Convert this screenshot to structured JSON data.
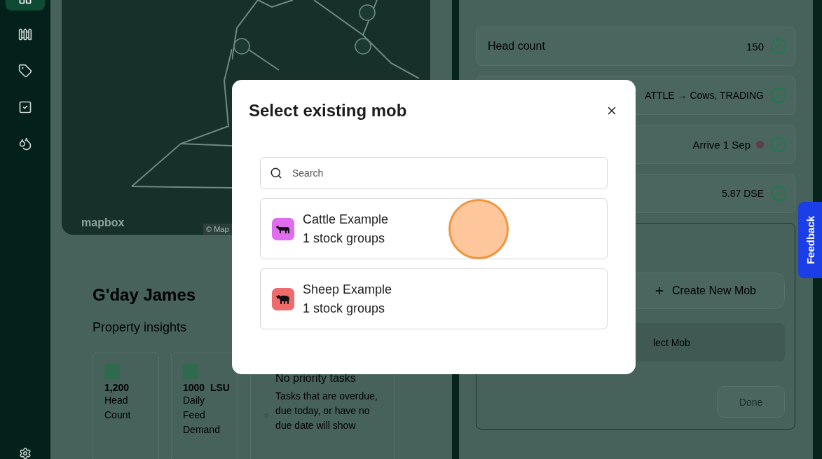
{
  "sidebar": {
    "items": [
      {
        "selected": true
      },
      {
        "selected": false
      },
      {
        "selected": false
      },
      {
        "selected": false
      },
      {
        "selected": false
      }
    ]
  },
  "map": {
    "logo": "mapbox",
    "attribution": "© Map"
  },
  "greeting": "G'day James",
  "insights_title": "Property insights",
  "insights": [
    {
      "kind": "stat",
      "value": "1,200",
      "label": "Head Count"
    },
    {
      "kind": "stat",
      "value": "1000",
      "unit": "LSU",
      "label": "Daily Feed Demand"
    },
    {
      "kind": "tasks",
      "title": "No priority tasks",
      "text": "Tasks that are overdue, due today, or have no due date will show"
    }
  ],
  "details": [
    {
      "label": "Head count",
      "value": "150",
      "done": true
    },
    {
      "value": "ATTLE → Cows, TRADING",
      "done": true
    },
    {
      "value": "Arrive 1 Sep",
      "color": "#5c3f4a",
      "done": true
    },
    {
      "value": "5.87 DSE",
      "done": true
    }
  ],
  "mob_section": {
    "create_button": "Create New Mob",
    "select": "lect Mob",
    "done_button": {
      "label": "Done",
      "disabled": true
    }
  },
  "feedback": "Feedback",
  "modal": {
    "title": "Select existing mob",
    "search": {
      "placeholder": "Search"
    },
    "mobs": [
      {
        "name": "Cattle Example",
        "groups": "1 stock groups",
        "kind": "cattle",
        "color": "#e06cef",
        "clicked": true
      },
      {
        "name": "Sheep Example",
        "groups": "1 stock groups",
        "kind": "sheep",
        "color": "#ef6a6a",
        "clicked": false
      }
    ]
  }
}
